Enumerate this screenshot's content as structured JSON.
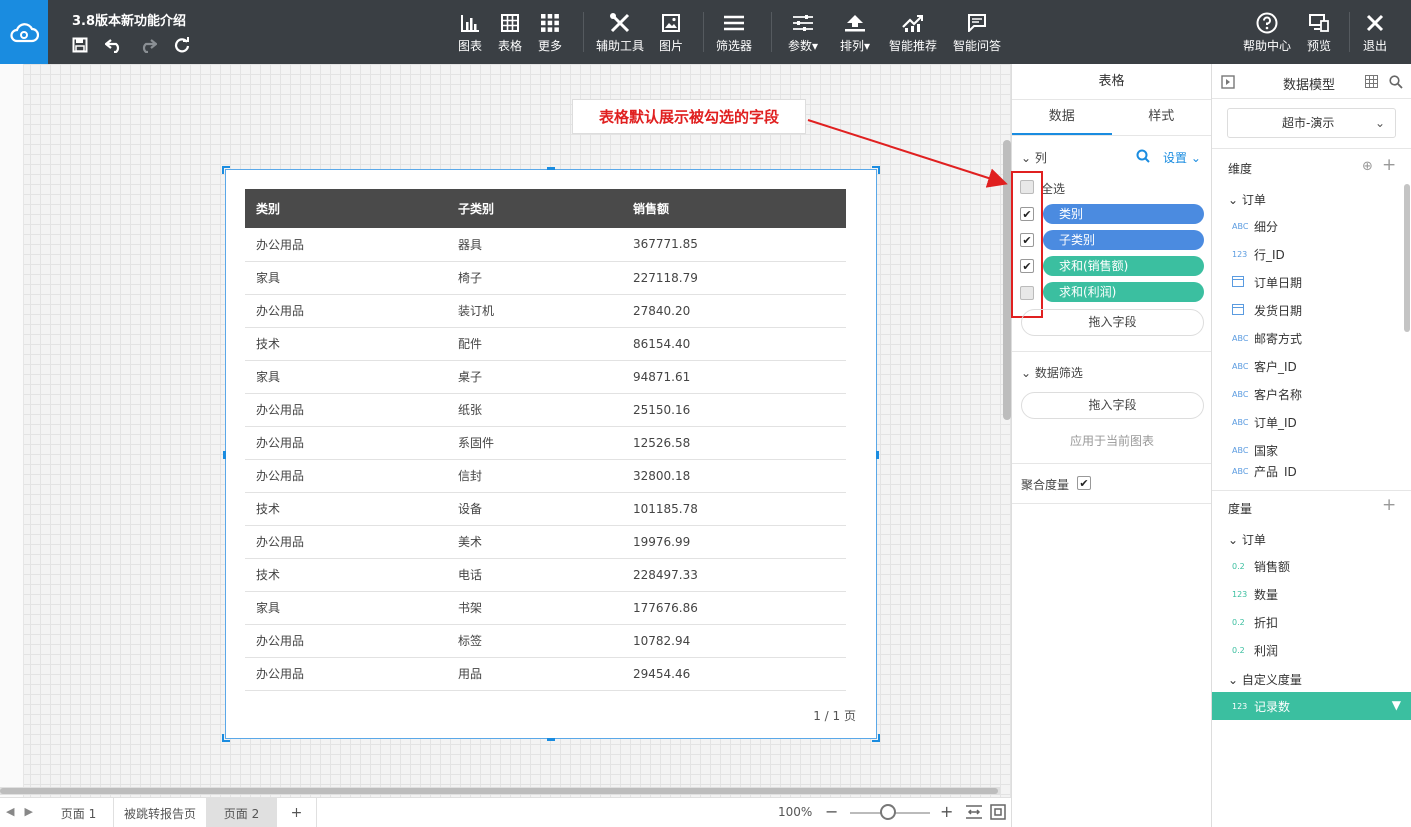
{
  "app": {
    "doc_title": "3.8版本新功能介绍"
  },
  "toolbar": {
    "chart": "图表",
    "table": "表格",
    "more": "更多",
    "aux_tools": "辅助工具",
    "image": "图片",
    "filter": "筛选器",
    "params": "参数",
    "sort": "排列",
    "smart_recommend": "智能推荐",
    "smart_qa": "智能问答",
    "help": "帮助中心",
    "preview": "预览",
    "exit": "退出"
  },
  "table": {
    "headers": [
      "类别",
      "子类别",
      "销售额"
    ],
    "rows": [
      [
        "办公用品",
        "器具",
        "367771.85"
      ],
      [
        "家具",
        "椅子",
        "227118.79"
      ],
      [
        "办公用品",
        "装订机",
        "27840.20"
      ],
      [
        "技术",
        "配件",
        "86154.40"
      ],
      [
        "家具",
        "桌子",
        "94871.61"
      ],
      [
        "办公用品",
        "纸张",
        "25150.16"
      ],
      [
        "办公用品",
        "系固件",
        "12526.58"
      ],
      [
        "办公用品",
        "信封",
        "32800.18"
      ],
      [
        "技术",
        "设备",
        "101185.78"
      ],
      [
        "办公用品",
        "美术",
        "19976.99"
      ],
      [
        "技术",
        "电话",
        "228497.33"
      ],
      [
        "家具",
        "书架",
        "177676.86"
      ],
      [
        "办公用品",
        "标签",
        "10782.94"
      ],
      [
        "办公用品",
        "用品",
        "29454.46"
      ]
    ],
    "pager": "1 / 1 页"
  },
  "annotation": {
    "callout": "表格默认展示被勾选的字段",
    "color": "#e02020"
  },
  "pages": {
    "tabs": [
      "页面 1",
      "被跳转报告页",
      "页面 2"
    ],
    "active": "页面 2",
    "add": "+",
    "zoom": "100%"
  },
  "table_panel": {
    "title": "表格",
    "tabs": [
      "数据",
      "样式"
    ],
    "columns_header": "列",
    "settings": "设置",
    "select_all": "全选",
    "fields": [
      {
        "label": "类别",
        "checked": true,
        "color": "#4b8be0"
      },
      {
        "label": "子类别",
        "checked": true,
        "color": "#4b8be0"
      },
      {
        "label": "求和(销售额)",
        "checked": true,
        "color": "#3bbfa0"
      },
      {
        "label": "求和(利润)",
        "checked": false,
        "color": "#3bbfa0"
      }
    ],
    "drop_field": "拖入字段",
    "data_filter": "数据筛选",
    "apply_current": "应用于当前图表",
    "agg_measure": "聚合度量"
  },
  "data_model": {
    "title": "数据模型",
    "model_name": "超市-演示",
    "dimensions_label": "维度",
    "dimension_group": "订单",
    "dimensions": [
      {
        "type": "ABC",
        "name": "细分"
      },
      {
        "type": "123",
        "name": "行_ID"
      },
      {
        "type": "date",
        "name": "订单日期"
      },
      {
        "type": "date",
        "name": "发货日期"
      },
      {
        "type": "ABC",
        "name": "邮寄方式"
      },
      {
        "type": "ABC",
        "name": "客户_ID"
      },
      {
        "type": "ABC",
        "name": "客户名称"
      },
      {
        "type": "ABC",
        "name": "订单_ID"
      },
      {
        "type": "ABC",
        "name": "国家"
      },
      {
        "type": "ABC",
        "name": "产品_ID"
      }
    ],
    "measures_label": "度量",
    "measure_group": "订单",
    "measures": [
      {
        "type": "0.2",
        "name": "销售额"
      },
      {
        "type": "123",
        "name": "数量"
      },
      {
        "type": "0.2",
        "name": "折扣"
      },
      {
        "type": "0.2",
        "name": "利润"
      }
    ],
    "custom_measures_label": "自定义度量",
    "custom_measure": {
      "type": "123",
      "name": "记录数"
    }
  }
}
